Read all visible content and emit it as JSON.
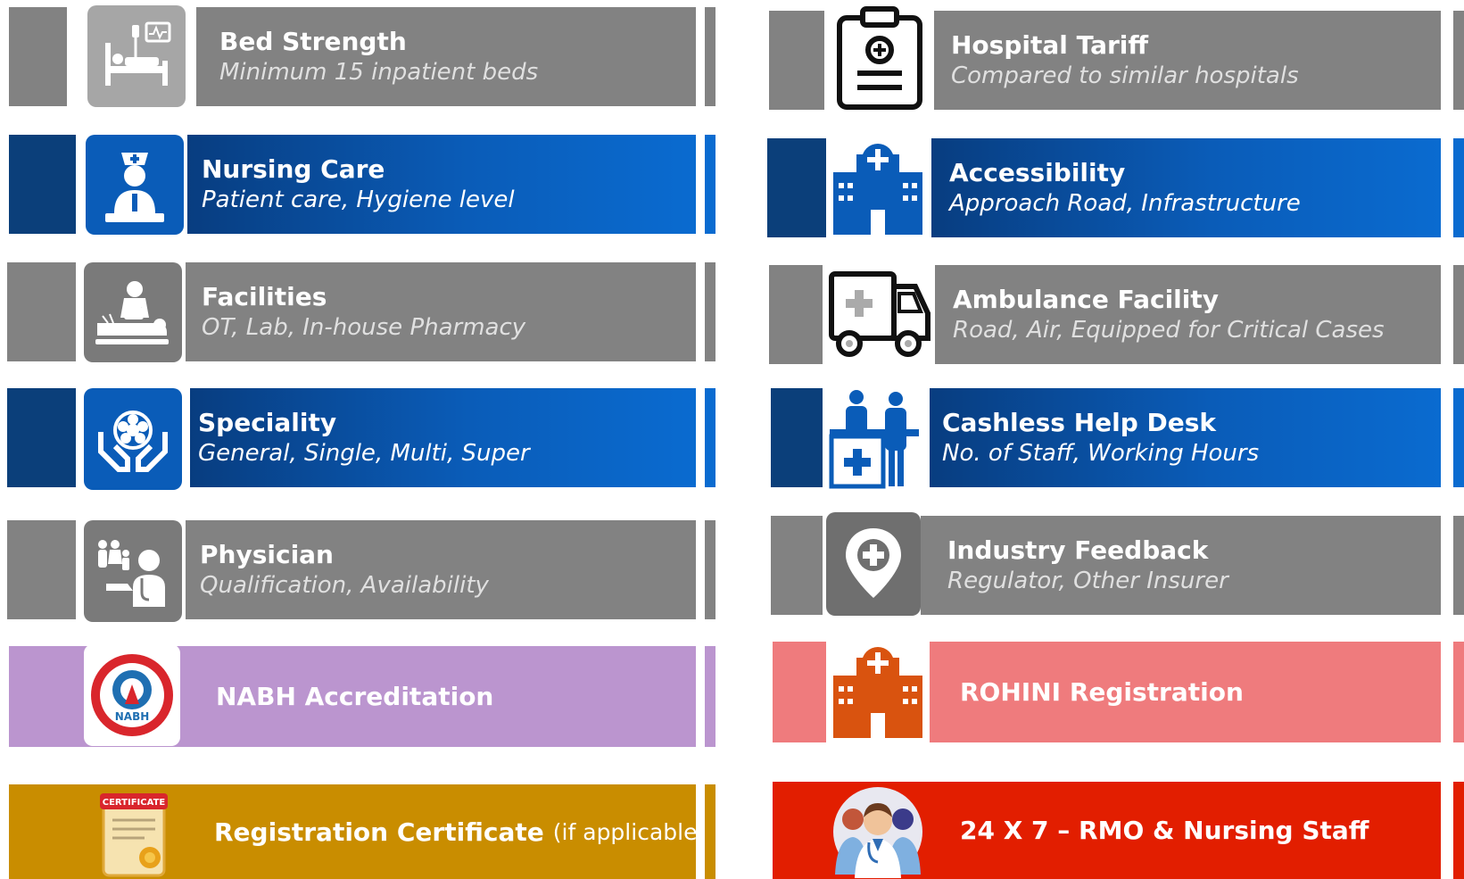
{
  "left": [
    {
      "title": "Bed Strength",
      "subtitle": "Minimum 15 inpatient beds",
      "icon": "hospital-bed-icon"
    },
    {
      "title": "Nursing Care",
      "subtitle": "Patient care, Hygiene level",
      "icon": "nurse-icon"
    },
    {
      "title": "Facilities",
      "subtitle": "OT, Lab, In-house Pharmacy",
      "icon": "patient-treatment-icon"
    },
    {
      "title": "Speciality",
      "subtitle": "General, Single, Multi, Super",
      "icon": "hands-cell-icon"
    },
    {
      "title": "Physician",
      "subtitle": "Qualification, Availability",
      "icon": "doctor-family-icon"
    },
    {
      "title": "NABH Accreditation",
      "icon": "nabh-seal-icon",
      "seal_text": "NABH"
    },
    {
      "title": "Registration Certificate",
      "note": "(if applicable)",
      "icon": "certificate-icon",
      "cert_text": "CERTIFICATE"
    }
  ],
  "right": [
    {
      "title": "Hospital Tariff",
      "subtitle": "Compared to similar hospitals",
      "icon": "clipboard-icon"
    },
    {
      "title": "Accessibility",
      "subtitle": "Approach Road, Infrastructure",
      "icon": "hospital-building-icon"
    },
    {
      "title": "Ambulance Facility",
      "subtitle": "Road, Air, Equipped for Critical Cases",
      "icon": "ambulance-icon"
    },
    {
      "title": "Cashless Help Desk",
      "subtitle": "No. of Staff, Working Hours",
      "icon": "help-desk-icon"
    },
    {
      "title": "Industry Feedback",
      "subtitle": "Regulator, Other Insurer",
      "icon": "location-plus-icon"
    },
    {
      "title": "ROHINI Registration",
      "icon": "hospital-building-orange-icon"
    },
    {
      "title": "24 X 7 – RMO & Nursing Staff",
      "icon": "medical-staff-icon"
    }
  ]
}
